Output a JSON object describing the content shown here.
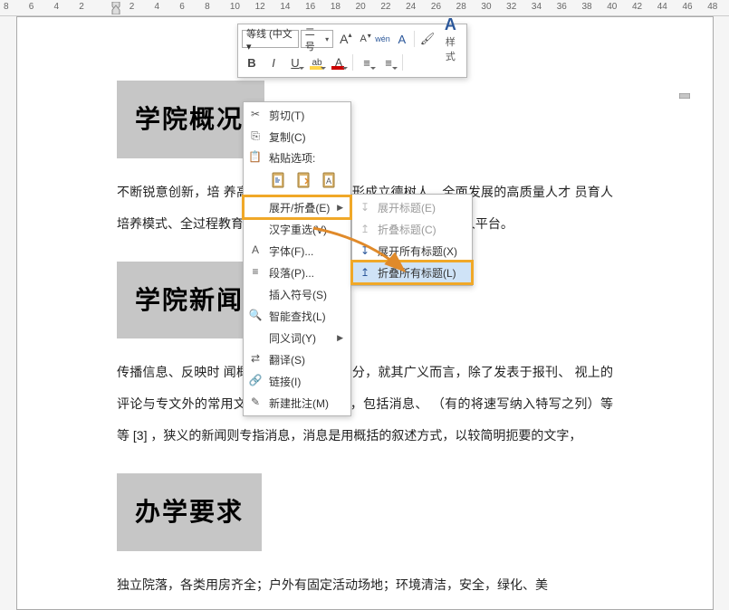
{
  "ruler": {
    "ticks": [
      "8",
      "6",
      "4",
      "2",
      "",
      "2",
      "4",
      "6",
      "8",
      "10",
      "12",
      "14",
      "16",
      "18",
      "20",
      "22",
      "24",
      "26",
      "28",
      "30",
      "32",
      "34",
      "36",
      "38",
      "40",
      "42",
      "44",
      "46",
      "48"
    ]
  },
  "mini_toolbar": {
    "font_name": "等线 (中文▾",
    "font_size": "二号",
    "grow": "A",
    "shrink": "A",
    "phonetic": "wén",
    "clear_fmt": "A",
    "format_painter": "✎",
    "styles_big": "A",
    "styles_label": "样式",
    "bold": "B",
    "italic": "I",
    "underline": "U",
    "highlight": "ab",
    "font_color": "A",
    "bullets": "≣",
    "numbering": "≣"
  },
  "context_menu": {
    "cut": "剪切(T)",
    "copy": "复制(C)",
    "paste_label": "粘贴选项:",
    "expand_collapse": "展开/折叠(E)",
    "reselect": "汉字重选(V)",
    "font": "字体(F)...",
    "paragraph": "段落(P)...",
    "insert_symbol": "插入符号(S)",
    "smart_lookup": "智能查找(L)",
    "synonyms": "同义词(Y)",
    "translate": "翻译(S)",
    "link": "链接(I)",
    "new_comment": "新建批注(M)"
  },
  "submenu": {
    "expand_heading": "展开标题(E)",
    "collapse_heading": "折叠标题(C)",
    "expand_all": "展开所有标题(X)",
    "collapse_all": "折叠所有标题(L)"
  },
  "doc": {
    "h1": "学院概况",
    "p1": "不断锐意创新，培                                   养高层次人才为使命，形成立德树人、全面发展的高质量人才                                   员育人培养模式、全过程教育生态圈和全方位教学互动机制，                                                           十大育人平台。",
    "h2": "学院新闻",
    "p2": "传播信息、反映时                                   闻概念有广义与狭义之分，就其广义而言，除了发表于报刊、                                   视上的评论与专文外的常用文本都属于新闻之列，包括消息、                                   （有的将速写纳入特写之列）等等 [3]  ，狭义的新闻则专指消息，消息是用概括的叙述方式，以较简明扼要的文字，",
    "h3": "办学要求",
    "p3": "独立院落，各类用房齐全；户外有固定活动场地；环境清洁，安全，绿化、美"
  }
}
